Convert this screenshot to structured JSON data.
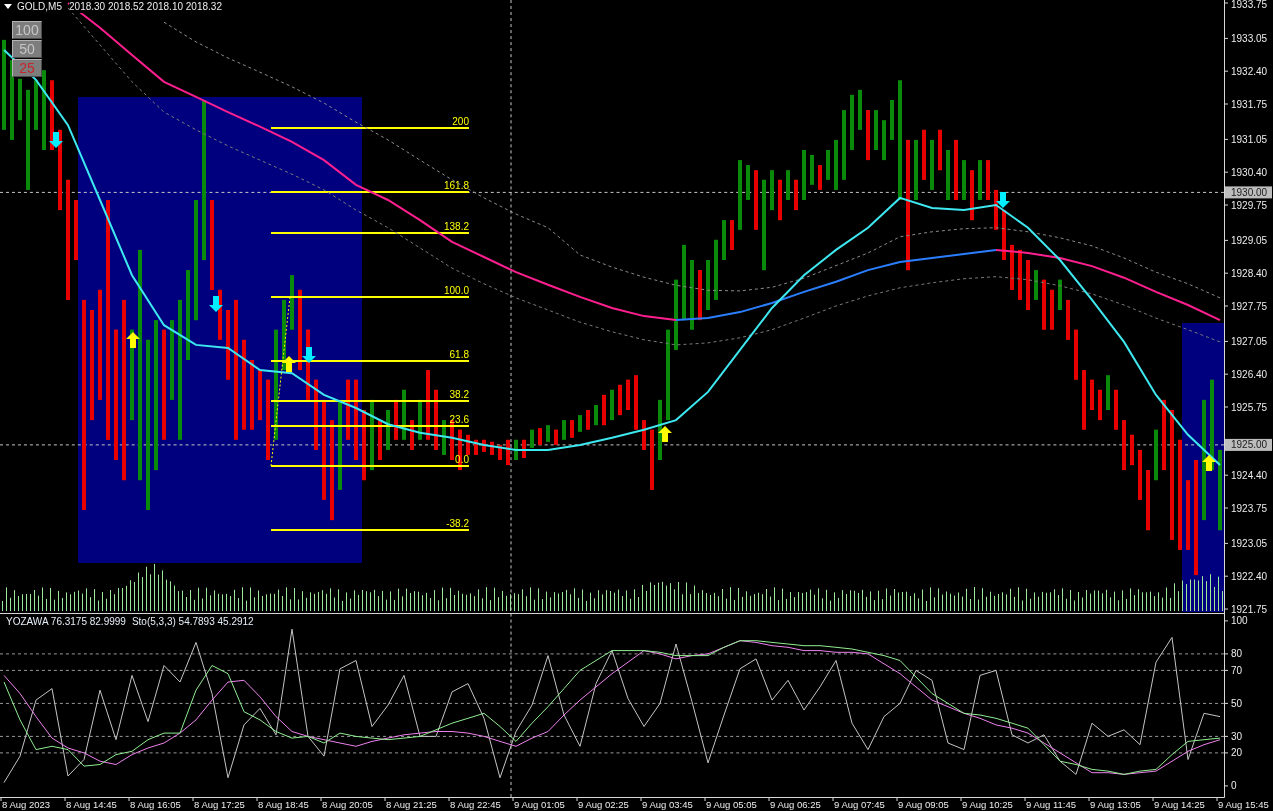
{
  "header": {
    "symbol": "GOLD,M5",
    "quote": "2018.30 2018.52 2018.10 2018.32"
  },
  "scale_buttons": [
    {
      "label": "100",
      "selected": false
    },
    {
      "label": "50",
      "selected": false
    },
    {
      "label": "25",
      "selected": true
    }
  ],
  "price_pane": {
    "chart_data": {
      "type": "candlestick",
      "ylim": [
        1921.75,
        1933.75
      ],
      "yticks": [
        {
          "value": 1933.75,
          "label": "1933.75"
        },
        {
          "value": 1933.05,
          "label": "1933.05"
        },
        {
          "value": 1932.4,
          "label": "1932.40"
        },
        {
          "value": 1931.75,
          "label": "1931.75"
        },
        {
          "value": 1931.05,
          "label": "1931.05"
        },
        {
          "value": 1930.4,
          "label": "1930.40"
        },
        {
          "value": 1929.75,
          "label": "1929.75"
        },
        {
          "value": 1929.05,
          "label": "1929.05"
        },
        {
          "value": 1928.4,
          "label": "1928.40"
        },
        {
          "value": 1927.75,
          "label": "1927.75"
        },
        {
          "value": 1927.05,
          "label": "1927.05"
        },
        {
          "value": 1926.4,
          "label": "1926.40"
        },
        {
          "value": 1925.75,
          "label": "1925.75"
        },
        {
          "value": 1924.4,
          "label": "1924.40"
        },
        {
          "value": 1923.75,
          "label": "1923.75"
        },
        {
          "value": 1923.05,
          "label": "1923.05"
        },
        {
          "value": 1922.4,
          "label": "1922.40"
        },
        {
          "value": 1921.75,
          "label": "1921.75"
        }
      ],
      "series": [
        {
          "ohlc": [
            [
              1931.24,
              1933.02,
              1931.24,
              1933.02
            ],
            [
              1931.04,
              1932.62,
              1931.04,
              1932.62
            ],
            [
              1931.43,
              1932.25,
              1931.43,
              1932.25
            ],
            [
              1930.05,
              1932.03,
              1930.05,
              1932.03
            ],
            [
              1931.24,
              1932.22,
              1931.24,
              1932.22
            ],
            [
              1930.84,
              1932.42,
              1930.84,
              1932.42
            ],
            [
              1932.22,
              1932.22,
              1930.84,
              1930.84
            ],
            [
              1931.24,
              1931.24,
              1929.65,
              1929.65
            ],
            [
              1930.25,
              1930.25,
              1927.87,
              1927.87
            ],
            [
              1929.85,
              1929.85,
              1928.66,
              1928.66
            ],
            [
              1927.87,
              1927.87,
              1923.71,
              1923.71
            ],
            [
              1927.67,
              1927.67,
              1925.49,
              1925.49
            ],
            [
              1928.07,
              1928.07,
              1925.89,
              1925.89
            ],
            [
              1929.85,
              1929.85,
              1925.1,
              1925.1
            ],
            [
              1927.28,
              1927.28,
              1924.7,
              1924.7
            ],
            [
              1927.87,
              1927.87,
              1924.3,
              1924.3
            ],
            [
              1925.49,
              1927.28,
              1925.49,
              1927.28
            ],
            [
              1924.3,
              1928.86,
              1924.3,
              1928.86
            ],
            [
              1923.71,
              1927.08,
              1923.71,
              1927.08
            ],
            [
              1924.5,
              1927.47,
              1924.5,
              1927.47
            ],
            [
              1927.28,
              1927.28,
              1925.1,
              1925.1
            ],
            [
              1925.89,
              1927.47,
              1925.89,
              1927.47
            ],
            [
              1925.1,
              1927.87,
              1925.1,
              1927.87
            ],
            [
              1926.68,
              1928.46,
              1926.68,
              1928.46
            ],
            [
              1927.47,
              1929.85,
              1927.47,
              1929.85
            ],
            [
              1928.66,
              1931.83,
              1928.66,
              1931.83
            ],
            [
              1929.85,
              1929.85,
              1928.07,
              1928.07
            ],
            [
              1928.07,
              1928.07,
              1927.08,
              1927.08
            ],
            [
              1927.67,
              1927.67,
              1926.29,
              1926.29
            ],
            [
              1927.87,
              1927.87,
              1925.1,
              1925.1
            ],
            [
              1927.08,
              1927.08,
              1925.3,
              1925.3
            ],
            [
              1926.68,
              1926.68,
              1925.3,
              1925.3
            ],
            [
              1926.48,
              1926.48,
              1925.49,
              1925.49
            ],
            [
              1926.29,
              1926.29,
              1924.7,
              1924.7
            ],
            [
              1925.1,
              1927.28,
              1925.1,
              1927.28
            ],
            [
              1926.48,
              1927.87,
              1926.48,
              1927.87
            ],
            [
              1927.28,
              1928.36,
              1927.28,
              1928.36
            ],
            [
              1928.07,
              1928.07,
              1926.48,
              1926.48
            ],
            [
              1927.28,
              1927.28,
              1925.89,
              1925.89
            ],
            [
              1926.29,
              1926.29,
              1924.9,
              1924.9
            ],
            [
              1925.89,
              1925.89,
              1923.91,
              1923.91
            ],
            [
              1925.49,
              1925.49,
              1923.51,
              1923.51
            ],
            [
              1924.11,
              1925.89,
              1924.11,
              1925.89
            ],
            [
              1926.29,
              1926.29,
              1925.1,
              1925.1
            ],
            [
              1926.29,
              1926.29,
              1924.7,
              1924.7
            ],
            [
              1925.69,
              1925.69,
              1924.3,
              1924.3
            ],
            [
              1924.5,
              1925.89,
              1924.5,
              1925.89
            ],
            [
              1925.49,
              1925.49,
              1924.7,
              1924.7
            ],
            [
              1924.9,
              1925.69,
              1924.9,
              1925.69
            ],
            [
              1925.89,
              1925.89,
              1925.1,
              1925.1
            ],
            [
              1925.1,
              1926.09,
              1925.1,
              1926.09
            ],
            [
              1925.49,
              1925.49,
              1924.9,
              1924.9
            ],
            [
              1925.1,
              1925.89,
              1925.1,
              1925.89
            ],
            [
              1926.48,
              1926.48,
              1925.1,
              1925.1
            ],
            [
              1926.09,
              1926.09,
              1924.9,
              1924.9
            ],
            [
              1924.8,
              1925.49,
              1924.8,
              1925.49
            ],
            [
              1925.49,
              1925.49,
              1924.7,
              1924.7
            ],
            [
              1925.3,
              1925.3,
              1924.5,
              1924.5
            ],
            [
              1925.2,
              1925.2,
              1924.8,
              1924.8
            ],
            [
              1925.1,
              1925.1,
              1924.8,
              1924.8
            ],
            [
              1925.1,
              1925.1,
              1924.86,
              1924.86
            ],
            [
              1925.06,
              1925.06,
              1924.8,
              1924.8
            ],
            [
              1925.0,
              1925.0,
              1924.7,
              1924.7
            ],
            [
              1925.1,
              1925.1,
              1924.6,
              1924.6
            ],
            [
              1924.7,
              1925.1,
              1924.7,
              1925.1
            ],
            [
              1925.1,
              1925.1,
              1924.74,
              1924.74
            ],
            [
              1924.94,
              1925.3,
              1924.94,
              1925.3
            ],
            [
              1925.33,
              1925.33,
              1925.0,
              1925.0
            ],
            [
              1925.06,
              1925.39,
              1925.06,
              1925.39
            ],
            [
              1925.3,
              1925.3,
              1925.0,
              1925.0
            ],
            [
              1925.1,
              1925.49,
              1925.1,
              1925.49
            ],
            [
              1925.49,
              1925.49,
              1925.14,
              1925.14
            ],
            [
              1925.26,
              1925.59,
              1925.26,
              1925.59
            ],
            [
              1925.69,
              1925.69,
              1925.3,
              1925.3
            ],
            [
              1925.39,
              1925.79,
              1925.39,
              1925.79
            ],
            [
              1925.99,
              1925.99,
              1925.39,
              1925.39
            ],
            [
              1925.49,
              1926.09,
              1925.49,
              1926.09
            ],
            [
              1926.19,
              1926.19,
              1925.59,
              1925.59
            ],
            [
              1926.29,
              1926.29,
              1925.69,
              1925.69
            ],
            [
              1926.38,
              1926.38,
              1925.3,
              1925.3
            ],
            [
              1925.49,
              1925.49,
              1924.9,
              1924.9
            ],
            [
              1925.3,
              1925.3,
              1924.11,
              1924.11
            ],
            [
              1924.7,
              1925.89,
              1924.7,
              1925.89
            ],
            [
              1925.49,
              1927.28,
              1925.49,
              1927.28
            ],
            [
              1926.88,
              1928.27,
              1926.88,
              1928.27
            ],
            [
              1927.47,
              1928.96,
              1927.47,
              1928.96
            ],
            [
              1927.28,
              1928.66,
              1927.28,
              1928.66
            ],
            [
              1928.46,
              1928.46,
              1927.47,
              1927.47
            ],
            [
              1927.67,
              1928.66,
              1927.67,
              1928.66
            ],
            [
              1927.87,
              1929.06,
              1927.87,
              1929.06
            ],
            [
              1928.66,
              1929.45,
              1928.66,
              1929.45
            ],
            [
              1929.45,
              1929.45,
              1928.86,
              1928.86
            ],
            [
              1929.26,
              1930.64,
              1929.26,
              1930.64
            ],
            [
              1929.85,
              1930.54,
              1929.85,
              1930.54
            ],
            [
              1930.44,
              1930.44,
              1929.26,
              1929.26
            ],
            [
              1928.46,
              1930.25,
              1928.46,
              1930.25
            ],
            [
              1929.65,
              1930.44,
              1929.65,
              1930.44
            ],
            [
              1930.25,
              1930.25,
              1929.45,
              1929.45
            ],
            [
              1929.85,
              1930.44,
              1929.85,
              1930.44
            ],
            [
              1930.25,
              1930.25,
              1929.65,
              1929.65
            ],
            [
              1929.85,
              1930.84,
              1929.85,
              1930.84
            ],
            [
              1930.15,
              1930.74,
              1930.15,
              1930.74
            ],
            [
              1930.54,
              1930.54,
              1930.05,
              1930.05
            ],
            [
              1930.25,
              1930.84,
              1930.25,
              1930.84
            ],
            [
              1930.05,
              1931.04,
              1930.05,
              1931.04
            ],
            [
              1930.25,
              1931.63,
              1930.25,
              1931.63
            ],
            [
              1930.84,
              1931.93,
              1930.84,
              1931.93
            ],
            [
              1931.24,
              1932.03,
              1931.24,
              1932.03
            ],
            [
              1931.63,
              1931.63,
              1930.64,
              1930.64
            ],
            [
              1930.84,
              1931.63,
              1930.84,
              1931.63
            ],
            [
              1930.64,
              1931.43,
              1930.64,
              1931.43
            ],
            [
              1931.04,
              1931.83,
              1931.04,
              1931.83
            ],
            [
              1929.85,
              1932.22,
              1929.85,
              1932.22
            ],
            [
              1931.04,
              1931.04,
              1928.46,
              1928.46
            ],
            [
              1929.85,
              1931.04,
              1929.85,
              1931.04
            ],
            [
              1931.24,
              1931.24,
              1930.25,
              1930.25
            ],
            [
              1930.05,
              1931.04,
              1930.05,
              1931.04
            ],
            [
              1931.24,
              1931.24,
              1930.44,
              1930.44
            ],
            [
              1929.85,
              1930.84,
              1929.85,
              1930.84
            ],
            [
              1931.04,
              1931.04,
              1929.85,
              1929.85
            ],
            [
              1929.85,
              1930.64,
              1929.85,
              1930.64
            ],
            [
              1930.44,
              1930.44,
              1929.45,
              1929.45
            ],
            [
              1929.85,
              1930.64,
              1929.85,
              1930.64
            ],
            [
              1930.64,
              1930.64,
              1929.85,
              1929.85
            ],
            [
              1930.05,
              1930.05,
              1929.26,
              1929.26
            ],
            [
              1929.65,
              1929.65,
              1928.66,
              1928.66
            ],
            [
              1928.96,
              1928.96,
              1928.07,
              1928.07
            ],
            [
              1928.86,
              1928.86,
              1927.87,
              1927.87
            ],
            [
              1928.66,
              1928.66,
              1927.67,
              1927.67
            ],
            [
              1927.87,
              1928.46,
              1927.87,
              1928.46
            ],
            [
              1928.27,
              1928.27,
              1927.28,
              1927.28
            ],
            [
              1928.07,
              1928.07,
              1927.28,
              1927.28
            ],
            [
              1927.67,
              1928.27,
              1927.67,
              1928.27
            ],
            [
              1927.87,
              1927.87,
              1927.08,
              1927.08
            ],
            [
              1927.28,
              1927.28,
              1926.29,
              1926.29
            ],
            [
              1926.48,
              1926.48,
              1925.3,
              1925.3
            ],
            [
              1926.29,
              1926.29,
              1925.69,
              1925.69
            ],
            [
              1926.09,
              1926.09,
              1925.49,
              1925.49
            ],
            [
              1925.69,
              1926.38,
              1925.69,
              1926.38
            ],
            [
              1926.09,
              1926.09,
              1925.3,
              1925.3
            ],
            [
              1925.49,
              1925.49,
              1924.5,
              1924.5
            ],
            [
              1925.2,
              1925.2,
              1924.6,
              1924.6
            ],
            [
              1924.9,
              1924.9,
              1923.91,
              1923.91
            ],
            [
              1924.5,
              1924.5,
              1923.31,
              1923.31
            ],
            [
              1924.3,
              1925.3,
              1924.3,
              1925.3
            ],
            [
              1925.89,
              1925.89,
              1924.5,
              1924.5
            ],
            [
              1925.69,
              1925.69,
              1923.12,
              1923.12
            ],
            [
              1925.1,
              1925.1,
              1922.92,
              1922.92
            ],
            [
              1924.3,
              1924.3,
              1922.92,
              1922.92
            ],
            [
              1924.7,
              1924.7,
              1922.42,
              1922.42
            ],
            [
              1923.51,
              1925.89,
              1923.51,
              1925.89
            ],
            [
              1924.5,
              1926.29,
              1924.5,
              1926.29
            ],
            [
              1923.31,
              1924.9,
              1923.31,
              1924.9
            ]
          ]
        }
      ],
      "ref_lines": [
        {
          "axis": "y",
          "value": 1930.0,
          "label": "1930.00"
        },
        {
          "axis": "y",
          "value": 1925.0,
          "label": "1925.00"
        }
      ],
      "annotations": [
        "200",
        "161.8",
        "138.2",
        "100.0",
        "61.8",
        "38.2",
        "23.6",
        "0.0",
        "-38.2"
      ]
    },
    "indicators": {
      "chart_data": {
        "type": "line",
        "ylim": [
          1921.75,
          1933.75
        ],
        "series": [
          {
            "color": "#8c8c8c",
            "line_style": "dashed",
            "values": [
              null,
              null,
              null,
              null,
              null,
              1933.37,
              1932.98,
              1932.66,
              1932.38,
              1932.09,
              1931.77,
              1931.39,
              1931.04,
              1930.64,
              1930.25,
              1929.89,
              1929.57,
              1929.3,
              1928.76,
              1928.52,
              1928.32,
              1928.16,
              1928.06,
              1928.05,
              1928.12,
              1928.3,
              1928.55,
              1928.8,
              1929.12,
              1929.22,
              1929.28,
              1929.3,
              1929.22,
              1929.1,
              1928.94,
              1928.7,
              1928.42,
              1928.19,
              1927.91
            ]
          },
          {
            "color": "#7a7a7a",
            "line_style": "dashed",
            "values": [
              null,
              null,
              1933.65,
              1932.92,
              1932.19,
              1931.59,
              1931.24,
              1930.92,
              1930.64,
              1930.36,
              1930.05,
              1929.65,
              1929.3,
              1928.9,
              1928.5,
              1928.19,
              1927.91,
              1927.67,
              1927.43,
              1927.24,
              1927.08,
              1926.98,
              1927.02,
              1927.12,
              1927.28,
              1927.51,
              1927.75,
              1927.95,
              1928.11,
              1928.21,
              1928.29,
              1928.33,
              1928.27,
              1928.15,
              1927.99,
              1927.77,
              1927.51,
              1927.28,
              1927.04
            ]
          },
          {
            "color": "#ff1f8f",
            "values": [
              null,
              null,
              1933.75,
              1933.26,
              1932.72,
              1932.19,
              1931.89,
              1931.59,
              1931.3,
              1931.0,
              1930.64,
              1930.15,
              1929.85,
              1929.45,
              1929.02,
              1928.72,
              1928.42,
              1928.17,
              1927.93,
              1927.71,
              1927.55,
              1927.47,
              null,
              null,
              null,
              null,
              null,
              null,
              null,
              null,
              null,
              1928.86,
              1928.8,
              1928.7,
              1928.54,
              1928.31,
              1928.03,
              1927.77,
              1927.47
            ]
          },
          {
            "color": "#2a7fff",
            "values": [
              null,
              null,
              null,
              null,
              null,
              null,
              null,
              null,
              null,
              null,
              null,
              null,
              null,
              null,
              null,
              null,
              null,
              null,
              null,
              null,
              null,
              1927.47,
              1927.51,
              1927.63,
              1927.81,
              1928.03,
              1928.23,
              1928.46,
              1928.62,
              1928.7,
              1928.78,
              1928.86,
              null,
              null,
              null,
              null,
              null,
              null,
              null
            ]
          },
          {
            "color": "#3ee8f0",
            "values": [
              1932.82,
              1932.23,
              1931.33,
              1929.85,
              1928.36,
              1927.37,
              1926.98,
              1926.92,
              1926.48,
              1926.42,
              1925.99,
              1925.73,
              1925.41,
              1925.24,
              1925.14,
              1925.0,
              1924.9,
              1924.9,
              1925.0,
              1925.14,
              1925.3,
              1925.49,
              1926.05,
              1926.88,
              1927.71,
              1928.36,
              1928.86,
              1929.3,
              1929.89,
              1929.69,
              1929.65,
              1929.75,
              1929.3,
              1928.66,
              1927.87,
              1927.04,
              1925.99,
              1925.2,
              1924.6
            ]
          }
        ]
      }
    }
  },
  "oscillator_pane": {
    "labels": [
      "YOZAWA 76.3175 82.9999",
      "Sto(5,3,3) 54.7893 45.2912"
    ],
    "chart_data": {
      "type": "line",
      "ylim": [
        -7,
        100
      ],
      "yticks": [
        100,
        80,
        70,
        50,
        30,
        20,
        0
      ],
      "grid": true,
      "series": [
        {
          "color": "#c4c4c4",
          "values": [
            2,
            18,
            52,
            59,
            6,
            16,
            58,
            28,
            67,
            39,
            73,
            63,
            87,
            56,
            5,
            37,
            47,
            31,
            95,
            30,
            18,
            71,
            76,
            36,
            49,
            67,
            30,
            30,
            57,
            62,
            41,
            5,
            33,
            49,
            79,
            43,
            24,
            62,
            82,
            53,
            36,
            50,
            86,
            51,
            14,
            43,
            71,
            77,
            52,
            64,
            46,
            60,
            76,
            38,
            22,
            42,
            50,
            70,
            64,
            26,
            22,
            67,
            70,
            31,
            26,
            31,
            15,
            7,
            38,
            30,
            34,
            25,
            75,
            90,
            16,
            44,
            42
          ]
        },
        {
          "color": "#ee82ee",
          "values": [
            67,
            56,
            42,
            29,
            23,
            20,
            15,
            13,
            19,
            23,
            26,
            32,
            40,
            52,
            63,
            64,
            54,
            42,
            33,
            30,
            28,
            26,
            24,
            27,
            29,
            31,
            32,
            33,
            33,
            32,
            30,
            27,
            24,
            29,
            33,
            43,
            52,
            60,
            68,
            75,
            82,
            80,
            77,
            79,
            80,
            84,
            88,
            87,
            85,
            84,
            82,
            82,
            81,
            81,
            80,
            74,
            68,
            60,
            52,
            48,
            44,
            41,
            37,
            35,
            32,
            26,
            20,
            14,
            8,
            8,
            7,
            8,
            9,
            15,
            21,
            25,
            28
          ]
        },
        {
          "color": "#90ee90",
          "values": [
            63,
            40,
            22,
            24,
            22,
            12,
            13,
            19,
            21,
            28,
            32,
            32,
            58,
            73,
            68,
            45,
            40,
            33,
            29,
            30,
            26,
            32,
            30,
            29,
            28,
            29,
            30,
            34,
            38,
            41,
            44,
            36,
            27,
            38,
            48,
            59,
            70,
            76,
            82,
            82,
            82,
            81,
            79,
            79,
            79,
            84,
            88,
            88,
            87,
            86,
            85,
            85,
            84,
            83,
            81,
            79,
            76,
            66,
            56,
            50,
            44,
            43,
            41,
            38,
            35,
            25,
            15,
            13,
            10,
            9,
            7,
            9,
            10,
            19,
            27,
            28,
            29
          ]
        }
      ]
    }
  },
  "time_axis": [
    "8 Aug 2023",
    "8 Aug 14:45",
    "8 Aug 16:05",
    "8 Aug 17:25",
    "8 Aug 18:45",
    "8 Aug 20:05",
    "8 Aug 21:25",
    "8 Aug 22:45",
    "9 Aug 01:05",
    "9 Aug 02:25",
    "9 Aug 03:45",
    "9 Aug 05:05",
    "9 Aug 06:25",
    "9 Aug 07:45",
    "9 Aug 09:05",
    "9 Aug 10:25",
    "9 Aug 11:45",
    "9 Aug 13:05",
    "9 Aug 14:25",
    "9 Aug 15:45"
  ]
}
